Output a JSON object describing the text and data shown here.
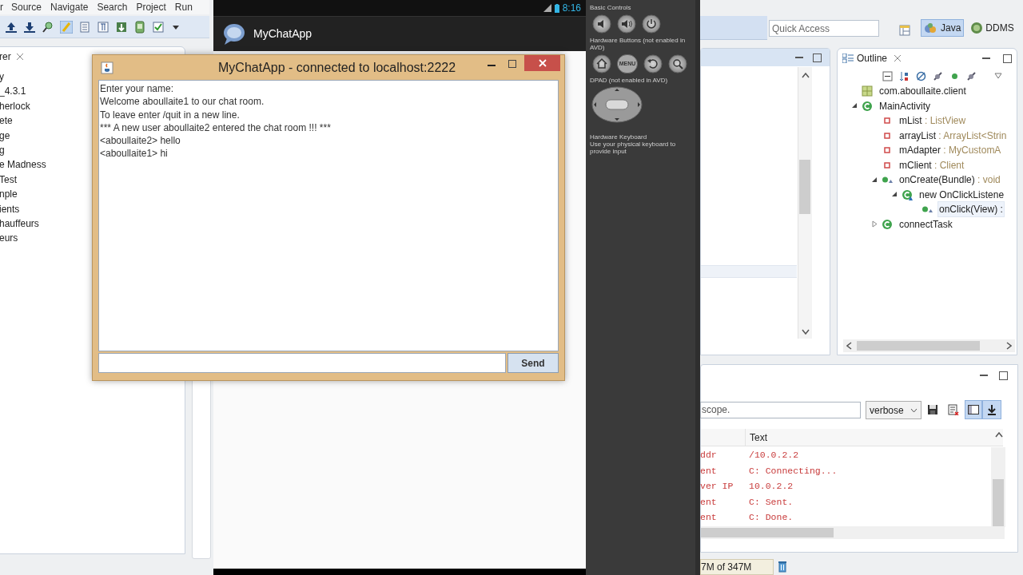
{
  "ide": {
    "menu": [
      "r",
      "Source",
      "Navigate",
      "Search",
      "Project",
      "Run"
    ],
    "quick_access": {
      "placeholder": "Quick Access"
    },
    "perspectives": [
      {
        "label": "Java",
        "selected": true
      },
      {
        "label": "DDMS",
        "selected": false
      }
    ],
    "explorer": {
      "title": "rer",
      "items": [
        "y",
        "_4.3.1",
        "herlock",
        "ete",
        "ge",
        "g",
        "e Madness",
        "Test",
        "nple",
        "ients",
        "hauffeurs",
        "eurs"
      ]
    },
    "outline": {
      "title": "Outline",
      "tree": [
        {
          "kind": "package",
          "name": "com.aboullaite.client"
        },
        {
          "kind": "class",
          "name": "MainActivity",
          "expanded": true,
          "children": [
            {
              "kind": "field",
              "name": "mList",
              "type": " : ListView"
            },
            {
              "kind": "field",
              "name": "arrayList",
              "type": " : ArrayList<Strin"
            },
            {
              "kind": "field",
              "name": "mAdapter",
              "type": " : MyCustomA"
            },
            {
              "kind": "field",
              "name": "mClient",
              "type": " : Client"
            },
            {
              "kind": "method",
              "name": "onCreate(Bundle)",
              "type": " : void",
              "expanded": true,
              "children": [
                {
                  "kind": "anon",
                  "name": "new OnClickListene",
                  "expanded": true,
                  "children": [
                    {
                      "kind": "method",
                      "name": "onClick(View) :",
                      "selected": true
                    }
                  ]
                }
              ]
            },
            {
              "kind": "class",
              "name": "connectTask",
              "expanded": false
            }
          ]
        }
      ]
    },
    "logcat": {
      "filter": "scope.",
      "level": "verbose",
      "column": "Text",
      "rows": [
        {
          "tag": "ddr",
          "text": "/10.0.2.2"
        },
        {
          "tag": "ent",
          "text": "C: Connecting..."
        },
        {
          "tag": "ver IP",
          "text": "10.0.2.2"
        },
        {
          "tag": "ent",
          "text": "C: Sent."
        },
        {
          "tag": "ent",
          "text": "C: Done."
        }
      ]
    },
    "heap": "7M of 347M"
  },
  "emulator": {
    "time": "8:16",
    "app_title": "MyChatApp",
    "sections": [
      {
        "title": "Basic Controls",
        "buttons": [
          {
            "kind": "vol_down"
          },
          {
            "kind": "vol_up"
          },
          {
            "kind": "power"
          }
        ]
      },
      {
        "title": "Hardware Buttons (not enabled in AVD)",
        "buttons": [
          {
            "kind": "home"
          },
          {
            "kind": "menu",
            "label": "MENU"
          },
          {
            "kind": "back"
          },
          {
            "kind": "search"
          }
        ]
      },
      {
        "title": "DPAD (not enabled in AVD)",
        "buttons": [
          {
            "kind": "dpad"
          }
        ]
      },
      {
        "title": "Hardware Keyboard",
        "note": "Use your physical keyboard to provide input"
      }
    ]
  },
  "chat_window": {
    "title": "MyChatApp - connected to localhost:2222",
    "lines": [
      "Enter your name:",
      "Welcome aboullaite1 to our chat room.",
      "To leave enter /quit in a new line.",
      "*** A new user aboullaite2 entered the chat room !!! ***",
      "<aboullaite2> hello",
      "<aboullaite1> hi"
    ],
    "send_button": "Send"
  }
}
